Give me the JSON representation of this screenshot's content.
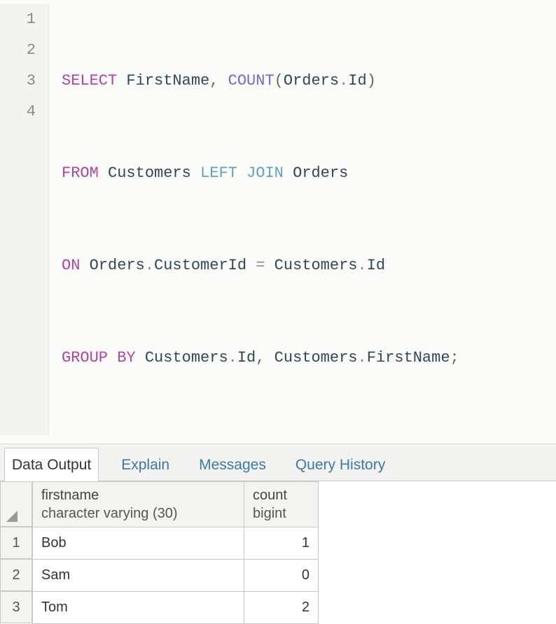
{
  "editor": {
    "lines": [
      "1",
      "2",
      "3",
      "4"
    ],
    "sql": {
      "l1": {
        "select": "SELECT",
        "col1": "FirstName",
        "comma": ",",
        "count": "COUNT",
        "lp": "(",
        "orders": "Orders",
        "dot": ".",
        "id": "Id",
        "rp": ")"
      },
      "l2": {
        "from": "FROM",
        "cust": "Customers",
        "left": "LEFT",
        "join": "JOIN",
        "orders": "Orders"
      },
      "l3": {
        "on": "ON",
        "orders": "Orders",
        "dot1": ".",
        "custid": "CustomerId",
        "eq": "=",
        "cust": "Customers",
        "dot2": ".",
        "id": "Id"
      },
      "l4": {
        "group": "GROUP",
        "by": "BY",
        "cust": "Customers",
        "dot1": ".",
        "id": "Id",
        "comma": ",",
        "cust2": "Customers",
        "dot2": ".",
        "first": "FirstName",
        "semi": ";"
      }
    }
  },
  "tabs": {
    "data_output": "Data Output",
    "explain": "Explain",
    "messages": "Messages",
    "query_history": "Query History"
  },
  "results": {
    "columns": [
      {
        "name": "firstname",
        "type": "character varying (30)"
      },
      {
        "name": "count",
        "type": "bigint"
      }
    ],
    "rows": [
      {
        "n": "1",
        "firstname": "Bob",
        "count": "1"
      },
      {
        "n": "2",
        "firstname": "Sam",
        "count": "0"
      },
      {
        "n": "3",
        "firstname": "Tom",
        "count": "2"
      }
    ]
  }
}
